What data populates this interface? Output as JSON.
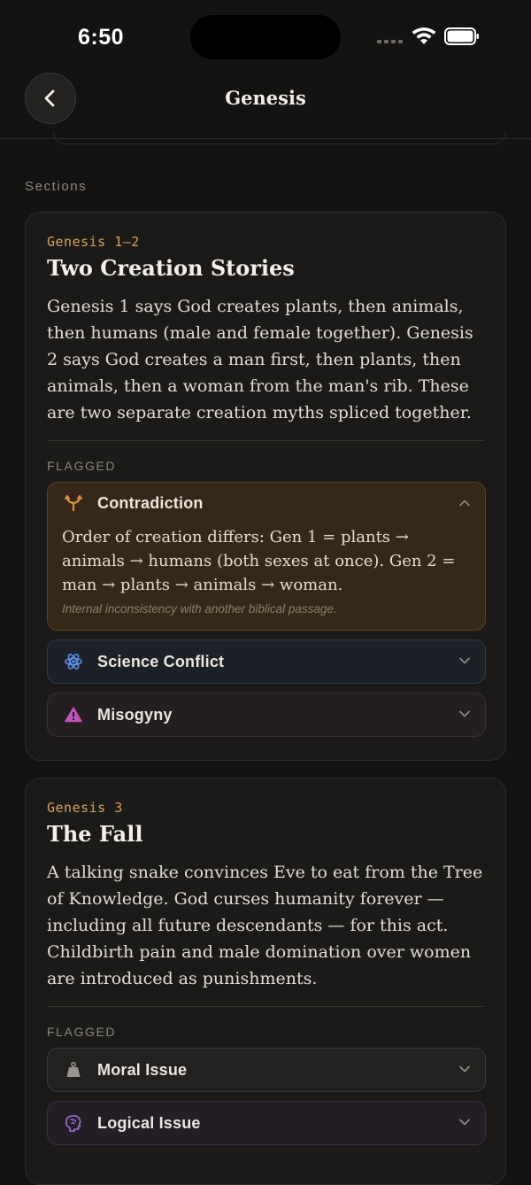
{
  "status_bar": {
    "time": "6:50"
  },
  "nav": {
    "title": "Genesis"
  },
  "sections_label": "Sections",
  "sections": [
    {
      "ref": "Genesis 1–2",
      "title": "Two Creation Stories",
      "body": "Genesis 1 says God creates plants, then animals, then humans (male and female together). Genesis 2 says God creates a man first, then plants, then animals, then a woman from the man's rib. These are two separate creation myths spliced together.",
      "flagged_label": "FLAGGED",
      "flags": [
        {
          "label": "Contradiction",
          "icon": "fork-icon",
          "expanded": true,
          "description": "Order of creation differs: Gen 1 = plants → animals → humans (both sexes at once). Gen 2 = man → plants → animals → woman.",
          "note": "Internal inconsistency with another biblical passage.",
          "color": "#d9953f"
        },
        {
          "label": "Science Conflict",
          "icon": "atom-icon",
          "expanded": false,
          "color": "#5b8fe0"
        },
        {
          "label": "Misogyny",
          "icon": "warning-triangle-icon",
          "expanded": false,
          "color": "#c254b8"
        }
      ]
    },
    {
      "ref": "Genesis 3",
      "title": "The Fall",
      "body": "A talking snake convinces Eve to eat from the Tree of Knowledge. God curses humanity forever — including all future descendants — for this act. Childbirth pain and male domination over women are introduced as punishments.",
      "flagged_label": "FLAGGED",
      "flags": [
        {
          "label": "Moral Issue",
          "icon": "weight-icon",
          "expanded": false,
          "color": "#9a958e"
        },
        {
          "label": "Logical Issue",
          "icon": "brain-icon",
          "expanded": false,
          "color": "#a272d8"
        }
      ]
    }
  ]
}
